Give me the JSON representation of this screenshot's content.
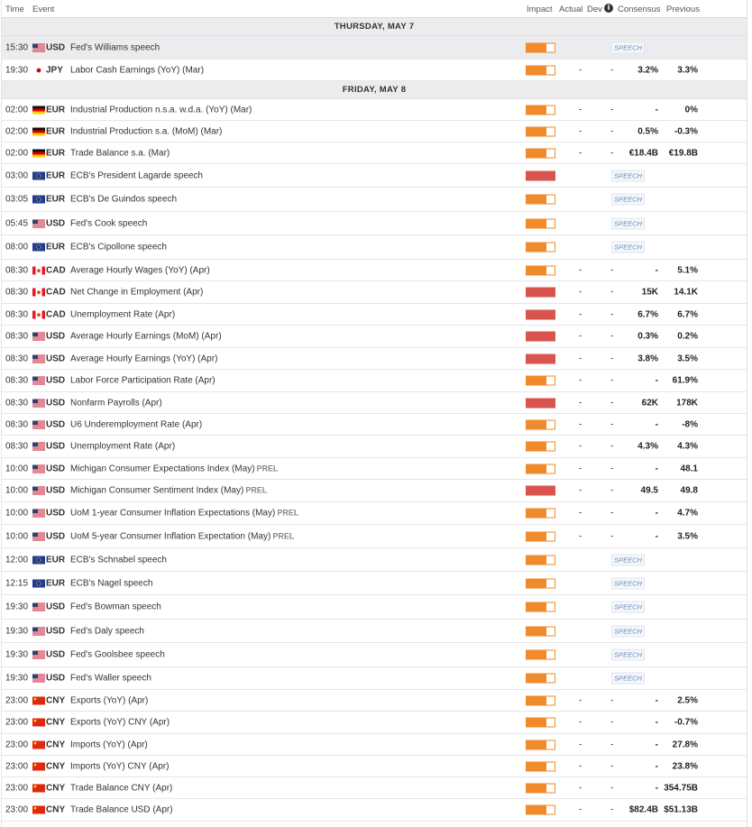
{
  "header": {
    "time": "Time",
    "event": "Event",
    "impact": "Impact",
    "actual": "Actual",
    "dev": "Dev",
    "info": "i",
    "consensus": "Consensus",
    "previous": "Previous"
  },
  "speech_label": "SPEECH",
  "colors": {
    "medium": "#f08a2b",
    "high": "#d9534f",
    "day_bg": "#ececef"
  },
  "days": [
    {
      "label": "THURSDAY, MAY 7",
      "events": [
        {
          "time": "15:30",
          "country": "us",
          "currency": "USD",
          "event": "Fed's Williams speech",
          "prel": "",
          "impact": "medium",
          "type": "speech",
          "actual": "",
          "dev": "",
          "consensus": "",
          "previous": "",
          "highlight": true
        },
        {
          "time": "19:30",
          "country": "jp",
          "currency": "JPY",
          "event": "Labor Cash Earnings (YoY) (Mar)",
          "prel": "",
          "impact": "medium",
          "type": "data",
          "actual": "-",
          "dev": "-",
          "consensus": "3.2%",
          "previous": "3.3%"
        }
      ]
    },
    {
      "label": "FRIDAY, MAY 8",
      "events": [
        {
          "time": "02:00",
          "country": "de",
          "currency": "EUR",
          "event": "Industrial Production n.s.a. w.d.a. (YoY) (Mar)",
          "prel": "",
          "impact": "medium",
          "type": "data",
          "actual": "-",
          "dev": "-",
          "consensus": "-",
          "previous": "0%"
        },
        {
          "time": "02:00",
          "country": "de",
          "currency": "EUR",
          "event": "Industrial Production s.a. (MoM) (Mar)",
          "prel": "",
          "impact": "medium",
          "type": "data",
          "actual": "-",
          "dev": "-",
          "consensus": "0.5%",
          "previous": "-0.3%"
        },
        {
          "time": "02:00",
          "country": "de",
          "currency": "EUR",
          "event": "Trade Balance s.a. (Mar)",
          "prel": "",
          "impact": "medium",
          "type": "data",
          "actual": "-",
          "dev": "-",
          "consensus": "€18.4B",
          "previous": "€19.8B"
        },
        {
          "time": "03:00",
          "country": "eu",
          "currency": "EUR",
          "event": "ECB's President Lagarde speech",
          "prel": "",
          "impact": "high",
          "type": "speech",
          "actual": "",
          "dev": "",
          "consensus": "",
          "previous": ""
        },
        {
          "time": "03:05",
          "country": "eu",
          "currency": "EUR",
          "event": "ECB's De Guindos speech",
          "prel": "",
          "impact": "medium",
          "type": "speech",
          "actual": "",
          "dev": "",
          "consensus": "",
          "previous": ""
        },
        {
          "time": "05:45",
          "country": "us",
          "currency": "USD",
          "event": "Fed's Cook speech",
          "prel": "",
          "impact": "medium",
          "type": "speech",
          "actual": "",
          "dev": "",
          "consensus": "",
          "previous": ""
        },
        {
          "time": "08:00",
          "country": "eu",
          "currency": "EUR",
          "event": "ECB's Cipollone speech",
          "prel": "",
          "impact": "medium",
          "type": "speech",
          "actual": "",
          "dev": "",
          "consensus": "",
          "previous": ""
        },
        {
          "time": "08:30",
          "country": "ca",
          "currency": "CAD",
          "event": "Average Hourly Wages (YoY) (Apr)",
          "prel": "",
          "impact": "medium",
          "type": "data",
          "actual": "-",
          "dev": "-",
          "consensus": "-",
          "previous": "5.1%"
        },
        {
          "time": "08:30",
          "country": "ca",
          "currency": "CAD",
          "event": "Net Change in Employment (Apr)",
          "prel": "",
          "impact": "high",
          "type": "data",
          "actual": "-",
          "dev": "-",
          "consensus": "15K",
          "previous": "14.1K"
        },
        {
          "time": "08:30",
          "country": "ca",
          "currency": "CAD",
          "event": "Unemployment Rate (Apr)",
          "prel": "",
          "impact": "high",
          "type": "data",
          "actual": "-",
          "dev": "-",
          "consensus": "6.7%",
          "previous": "6.7%"
        },
        {
          "time": "08:30",
          "country": "us",
          "currency": "USD",
          "event": "Average Hourly Earnings (MoM) (Apr)",
          "prel": "",
          "impact": "high",
          "type": "data",
          "actual": "-",
          "dev": "-",
          "consensus": "0.3%",
          "previous": "0.2%"
        },
        {
          "time": "08:30",
          "country": "us",
          "currency": "USD",
          "event": "Average Hourly Earnings (YoY) (Apr)",
          "prel": "",
          "impact": "high",
          "type": "data",
          "actual": "-",
          "dev": "-",
          "consensus": "3.8%",
          "previous": "3.5%"
        },
        {
          "time": "08:30",
          "country": "us",
          "currency": "USD",
          "event": "Labor Force Participation Rate (Apr)",
          "prel": "",
          "impact": "medium",
          "type": "data",
          "actual": "-",
          "dev": "-",
          "consensus": "-",
          "previous": "61.9%"
        },
        {
          "time": "08:30",
          "country": "us",
          "currency": "USD",
          "event": "Nonfarm Payrolls (Apr)",
          "prel": "",
          "impact": "high",
          "type": "data",
          "actual": "-",
          "dev": "-",
          "consensus": "62K",
          "previous": "178K"
        },
        {
          "time": "08:30",
          "country": "us",
          "currency": "USD",
          "event": "U6 Underemployment Rate (Apr)",
          "prel": "",
          "impact": "medium",
          "type": "data",
          "actual": "-",
          "dev": "-",
          "consensus": "-",
          "previous": "-8%"
        },
        {
          "time": "08:30",
          "country": "us",
          "currency": "USD",
          "event": "Unemployment Rate (Apr)",
          "prel": "",
          "impact": "medium",
          "type": "data",
          "actual": "-",
          "dev": "-",
          "consensus": "4.3%",
          "previous": "4.3%"
        },
        {
          "time": "10:00",
          "country": "us",
          "currency": "USD",
          "event": "Michigan Consumer Expectations Index (May)",
          "prel": "PREL",
          "impact": "medium",
          "type": "data",
          "actual": "-",
          "dev": "-",
          "consensus": "-",
          "previous": "48.1"
        },
        {
          "time": "10:00",
          "country": "us",
          "currency": "USD",
          "event": "Michigan Consumer Sentiment Index (May)",
          "prel": "PREL",
          "impact": "high",
          "type": "data",
          "actual": "-",
          "dev": "-",
          "consensus": "49.5",
          "previous": "49.8"
        },
        {
          "time": "10:00",
          "country": "us",
          "currency": "USD",
          "event": "UoM 1-year Consumer Inflation Expectations (May)",
          "prel": "PREL",
          "impact": "medium",
          "type": "data",
          "actual": "-",
          "dev": "-",
          "consensus": "-",
          "previous": "4.7%"
        },
        {
          "time": "10:00",
          "country": "us",
          "currency": "USD",
          "event": "UoM 5-year Consumer Inflation Expectation (May)",
          "prel": "PREL",
          "impact": "medium",
          "type": "data",
          "actual": "-",
          "dev": "-",
          "consensus": "-",
          "previous": "3.5%"
        },
        {
          "time": "12:00",
          "country": "eu",
          "currency": "EUR",
          "event": "ECB's Schnabel speech",
          "prel": "",
          "impact": "medium",
          "type": "speech",
          "actual": "",
          "dev": "",
          "consensus": "",
          "previous": ""
        },
        {
          "time": "12:15",
          "country": "eu",
          "currency": "EUR",
          "event": "ECB's Nagel speech",
          "prel": "",
          "impact": "medium",
          "type": "speech",
          "actual": "",
          "dev": "",
          "consensus": "",
          "previous": ""
        },
        {
          "time": "19:30",
          "country": "us",
          "currency": "USD",
          "event": "Fed's Bowman speech",
          "prel": "",
          "impact": "medium",
          "type": "speech",
          "actual": "",
          "dev": "",
          "consensus": "",
          "previous": ""
        },
        {
          "time": "19:30",
          "country": "us",
          "currency": "USD",
          "event": "Fed's Daly speech",
          "prel": "",
          "impact": "medium",
          "type": "speech",
          "actual": "",
          "dev": "",
          "consensus": "",
          "previous": ""
        },
        {
          "time": "19:30",
          "country": "us",
          "currency": "USD",
          "event": "Fed's Goolsbee speech",
          "prel": "",
          "impact": "medium",
          "type": "speech",
          "actual": "",
          "dev": "",
          "consensus": "",
          "previous": ""
        },
        {
          "time": "19:30",
          "country": "us",
          "currency": "USD",
          "event": "Fed's Waller speech",
          "prel": "",
          "impact": "medium",
          "type": "speech",
          "actual": "",
          "dev": "",
          "consensus": "",
          "previous": ""
        },
        {
          "time": "23:00",
          "country": "cn",
          "currency": "CNY",
          "event": "Exports (YoY) (Apr)",
          "prel": "",
          "impact": "medium",
          "type": "data",
          "actual": "-",
          "dev": "-",
          "consensus": "-",
          "previous": "2.5%"
        },
        {
          "time": "23:00",
          "country": "cn",
          "currency": "CNY",
          "event": "Exports (YoY) CNY (Apr)",
          "prel": "",
          "impact": "medium",
          "type": "data",
          "actual": "-",
          "dev": "-",
          "consensus": "-",
          "previous": "-0.7%"
        },
        {
          "time": "23:00",
          "country": "cn",
          "currency": "CNY",
          "event": "Imports (YoY) (Apr)",
          "prel": "",
          "impact": "medium",
          "type": "data",
          "actual": "-",
          "dev": "-",
          "consensus": "-",
          "previous": "27.8%"
        },
        {
          "time": "23:00",
          "country": "cn",
          "currency": "CNY",
          "event": "Imports (YoY) CNY (Apr)",
          "prel": "",
          "impact": "medium",
          "type": "data",
          "actual": "-",
          "dev": "-",
          "consensus": "-",
          "previous": "23.8%"
        },
        {
          "time": "23:00",
          "country": "cn",
          "currency": "CNY",
          "event": "Trade Balance CNY (Apr)",
          "prel": "",
          "impact": "medium",
          "type": "data",
          "actual": "-",
          "dev": "-",
          "consensus": "-",
          "previous": "354.75B"
        },
        {
          "time": "23:00",
          "country": "cn",
          "currency": "CNY",
          "event": "Trade Balance USD (Apr)",
          "prel": "",
          "impact": "medium",
          "type": "data",
          "actual": "-",
          "dev": "-",
          "consensus": "$82.4B",
          "previous": "$51.13B"
        }
      ]
    }
  ]
}
